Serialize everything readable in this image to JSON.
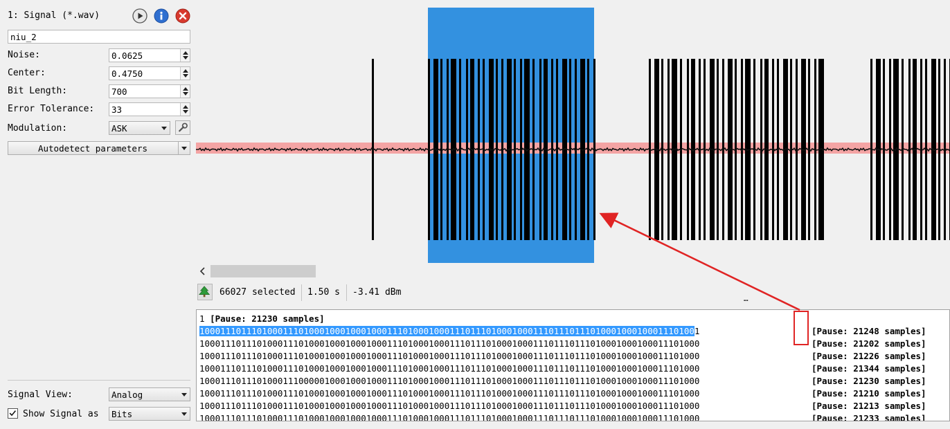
{
  "signal": {
    "header": "1: Signal (*.wav)",
    "name": "niu_2",
    "play_icon": "play-circle-icon",
    "info_icon": "info-circle-icon",
    "close_icon": "close-circle-icon"
  },
  "params": {
    "noise_label": "Noise:",
    "noise_value": "0.0625",
    "center_label": "Center:",
    "center_value": "0.4750",
    "bitlen_label": "Bit Length:",
    "bitlen_value": "700",
    "errtol_label": "Error Tolerance:",
    "errtol_value": "33",
    "mod_label": "Modulation:",
    "mod_value": "ASK",
    "autodetect_label": "Autodetect parameters"
  },
  "bottom": {
    "view_label": "Signal View:",
    "view_value": "Analog",
    "show_label": "Show Signal as",
    "show_value": "Bits",
    "show_checked": true
  },
  "status": {
    "selected": "66027 selected",
    "duration": "1.50 s",
    "power": "-3.41 dBm",
    "grip": "…"
  },
  "bits": {
    "first_line_index": "1",
    "first_line_pause": "[Pause: 21230 samples]",
    "selected_bits": "10001110111010001110100010001000100011101000100011101110100010001110111011101000100010001110100",
    "rows": [
      {
        "bits": "10001110111010001110100010001000100011101000100011101110100010001110111011101000100010001110100",
        "tail": "1",
        "pause": "[Pause: 21248 samples]"
      },
      {
        "bits": "100011101110100011101000100010001000111010001000111011101000100011101110111010001000100011101000",
        "tail": "1",
        "pause": "[Pause: 21202 samples]"
      },
      {
        "bits": "100011101110100011101000100010001000111010001000111011101000100011101110111010001000100011101000",
        "tail": "1",
        "pause": "[Pause: 21226 samples]"
      },
      {
        "bits": "100011101110100011101000100010001000111010001000111011101000100011101110111010001000100011101000",
        "tail": "1",
        "pause": "[Pause: 21344 samples]"
      },
      {
        "bits": "100011101110100011100000100010001000111010001000111011101000100011101110111010001000100011101000",
        "tail": "1",
        "pause": "[Pause: 21230 samples]"
      },
      {
        "bits": "100011101110100011101000100010001000111010001000111011101000100011101110111010001000100011101000",
        "tail": "1",
        "pause": "[Pause: 21210 samples]"
      },
      {
        "bits": "100011101110100011101000100010001000111010001000111011101000100011101110111010001000100011101000",
        "tail": "1",
        "pause": "[Pause: 21213 samples]"
      },
      {
        "bits": "100011101110100011101000100010001000111010001000111011101000100011101110111010001000100011101000",
        "tail": "1",
        "pause": "[Pause: 21233 samples]"
      }
    ]
  },
  "colors": {
    "selection": "#3391e0",
    "noise_band": "#f4a4a4",
    "annotation_red": "#e02424",
    "text_selection": "#3399ff"
  }
}
